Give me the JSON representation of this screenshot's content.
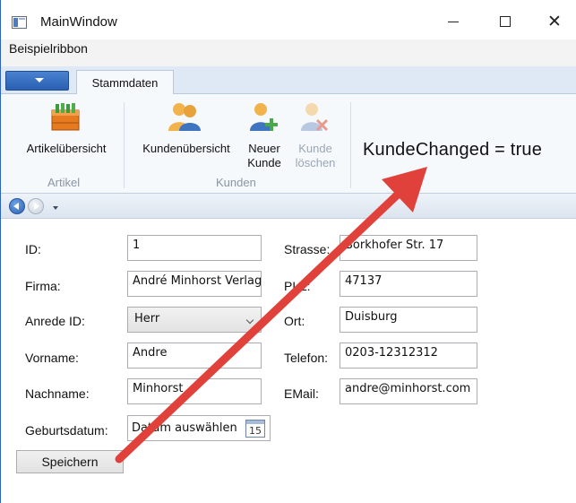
{
  "window": {
    "title": "MainWindow",
    "controls": {
      "minimize": "—",
      "maximize": "",
      "close": "✕"
    }
  },
  "ribbon_title": "Beispielribbon",
  "ribbon": {
    "tabs": [
      {
        "label": "Stammdaten",
        "selected": true
      }
    ],
    "groups": {
      "artikel": {
        "label": "Artikel",
        "buttons": {
          "artikel_uebersicht": "Artikelübersicht"
        }
      },
      "kunden": {
        "label": "Kunden",
        "buttons": {
          "kunden_uebersicht": "Kundenübersicht",
          "neuer_kunde_l1": "Neuer",
          "neuer_kunde_l2": "Kunde",
          "kunde_loeschen_l1": "Kunde",
          "kunde_loeschen_l2": "löschen"
        }
      }
    },
    "status": "KundeChanged = true"
  },
  "form": {
    "id": {
      "label": "ID:",
      "value": "1"
    },
    "firma": {
      "label": "Firma:",
      "value": "André Minhorst Verlag"
    },
    "anrede": {
      "label": "Anrede ID:",
      "value": "Herr"
    },
    "vorname": {
      "label": "Vorname:",
      "value": "Andre"
    },
    "nachname": {
      "label": "Nachname:",
      "value": "Minhorst"
    },
    "geburtsdatum": {
      "label": "Geburtsdatum:",
      "placeholder": "Datum auswählen",
      "calendar_day": "15"
    },
    "strasse": {
      "label": "Strasse:",
      "value": "Borkhofer Str. 17"
    },
    "plz": {
      "label": "PLZ:",
      "value": "47137"
    },
    "ort": {
      "label": "Ort:",
      "value": "Duisburg"
    },
    "telefon": {
      "label": "Telefon:",
      "value": "0203-12312312"
    },
    "email": {
      "label": "EMail:",
      "value": "andre@minhorst.com"
    },
    "save_label": "Speichern"
  },
  "colors": {
    "annotation_arrow": "#e0413a",
    "window_border": "#2b63c9",
    "ribbon_bg": "#f6f9fc"
  }
}
